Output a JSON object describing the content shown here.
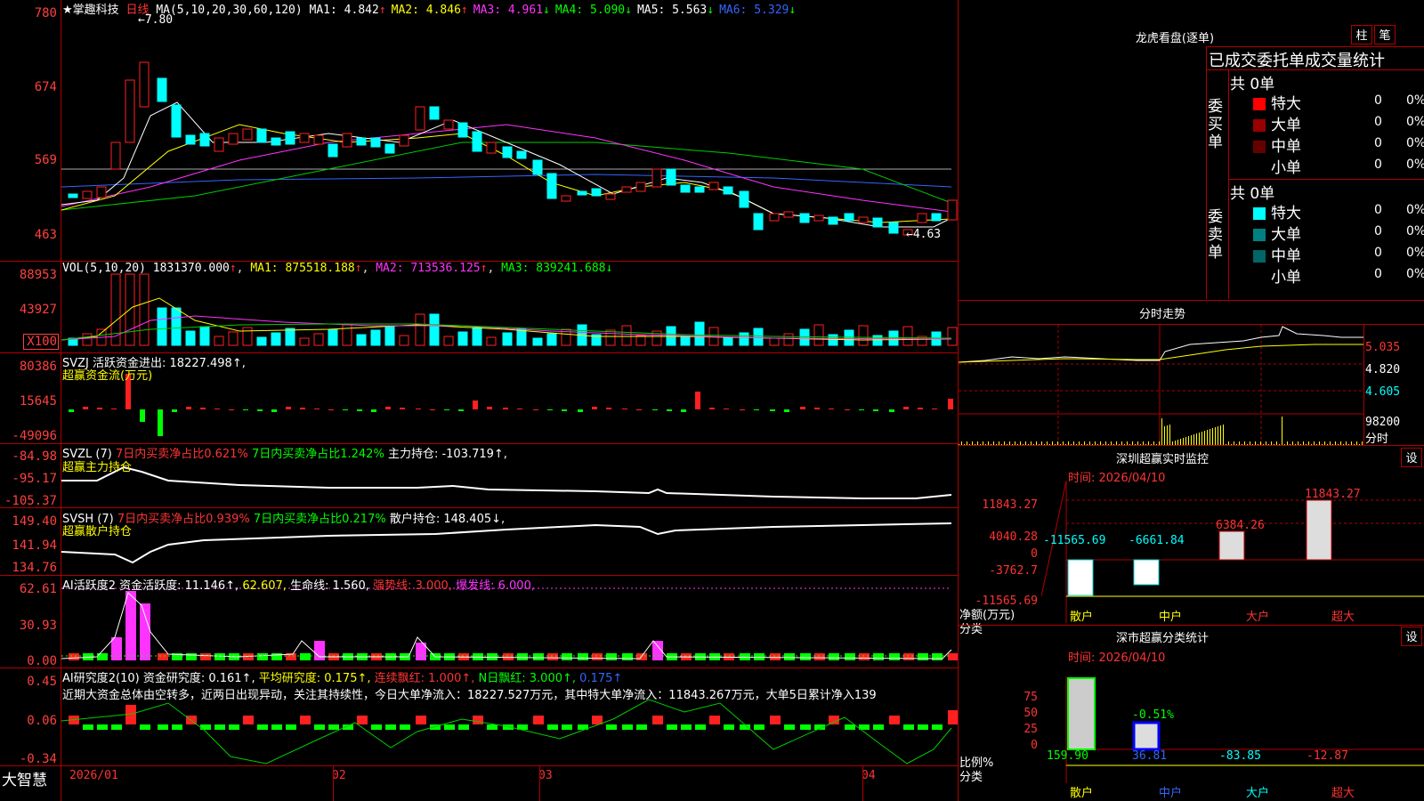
{
  "stock": {
    "name": "★掌趣科技",
    "period": "日线",
    "ma_header": "MA(5,10,20,30,60,120)",
    "ma": [
      {
        "label": "MA1: 4.842",
        "arrow": "↑",
        "color": "#ffffff"
      },
      {
        "label": "MA2: 4.846",
        "arrow": "↑",
        "color": "#ffff00"
      },
      {
        "label": "MA3: 4.961",
        "arrow": "↓",
        "color": "#ff33ff"
      },
      {
        "label": "MA4: 5.090",
        "arrow": "↓",
        "color": "#00ff00"
      },
      {
        "label": "MA5: 5.563",
        "arrow": "↓",
        "color": "#ffffff"
      },
      {
        "label": "MA6: 5.329",
        "arrow": "↓",
        "color": "#3366ff"
      }
    ],
    "high_marker": "7.80",
    "low_marker": "4.63",
    "price_axis": [
      "780",
      "674",
      "569",
      "463"
    ],
    "vol_axis": [
      "88953",
      "43927",
      "X100"
    ],
    "svzj_axis": [
      "80386",
      "15645",
      "-49096"
    ],
    "svzl_axis": [
      "-84.98",
      "-95.17",
      "-105.37"
    ],
    "svsh_axis": [
      "149.40",
      "141.94",
      "134.76"
    ],
    "ai1_axis": [
      "62.61",
      "30.93",
      "0.00"
    ],
    "ai2_axis": [
      "0.45",
      "0.06",
      "-0.34"
    ],
    "date_labels": [
      "2026/01",
      "02",
      "03",
      "04"
    ],
    "brand": "大智慧"
  },
  "vol": {
    "header": "VOL(5,10,20)",
    "value": "1831370.000",
    "ma1": "MA1: 875518.188",
    "ma2": "MA2: 713536.125",
    "ma3": "MA3: 839241.688"
  },
  "svzj": {
    "header": "SVZJ  活跃资金进出: 18227.498↑,",
    "sub": "超赢资金流(万元)"
  },
  "svzl": {
    "header": "SVZL (7)",
    "a": "7日内买卖净占比0.621%",
    "b": "7日内买卖净占比1.242%",
    "c": "主力持仓: -103.719↑,",
    "sub": "超赢主力持仓"
  },
  "svsh": {
    "header": "SVSH (7)",
    "a": "7日内买卖净占比0.939%",
    "b": "7日内买卖净占比0.217%",
    "c": "散户持仓: 148.405↓,",
    "sub": "超赢散户持仓"
  },
  "ai1": {
    "header": "AI活跃度2",
    "a": "资金活跃度: 11.146↑,",
    "b": "62.607,",
    "c": "生命线: 1.560,",
    "d": "强势线: 3.000,",
    "e": "爆发线: 6.000,"
  },
  "ai2": {
    "header": "AI研究度2(10)",
    "a": "资金研究度: 0.161↑,",
    "b": "平均研究度: 0.175↑,",
    "c": "连续飘红: 1.000↑,",
    "d": "N日飘红: 3.000↑,",
    "e": "0.175↑",
    "text": "近期大资金总体由空转多，近两日出现异动，关注其持续性，今日大单净流入：18227.527万元，其中特大单净流入：11843.267万元，大单5日累计净入139"
  },
  "right": {
    "title": "龙虎看盘(逐单)",
    "tab1": "柱",
    "tab2": "笔",
    "order_title": "已成交委托单成交量统计",
    "buy_label": "委买单",
    "sell_label": "委卖单",
    "buy_total": "共 0单",
    "sell_total": "共 0单",
    "buy_rows": [
      {
        "name": "特大",
        "val": "0",
        "pct": "0%",
        "color": "#ff0000"
      },
      {
        "name": "大单",
        "val": "0",
        "pct": "0%",
        "color": "#990000"
      },
      {
        "name": "中单",
        "val": "0",
        "pct": "0%",
        "color": "#660000"
      },
      {
        "name": "小单",
        "val": "0",
        "pct": "0%",
        "color": "#000000"
      }
    ],
    "sell_rows": [
      {
        "name": "特大",
        "val": "0",
        "pct": "0%",
        "color": "#00ffff"
      },
      {
        "name": "大单",
        "val": "0",
        "pct": "0%",
        "color": "#008080"
      },
      {
        "name": "中单",
        "val": "0",
        "pct": "0%",
        "color": "#006666"
      },
      {
        "name": "小单",
        "val": "0",
        "pct": "0%",
        "color": "#000000"
      }
    ],
    "intraday_title": "分时走势",
    "intraday_axis": [
      "5.035",
      "4.820",
      "4.605",
      "98200",
      "分时"
    ],
    "monitor_title": "深圳超赢实时监控",
    "monitor_date": "时间: 2026/04/10",
    "monitor_axis": [
      "11843.27",
      "4040.28",
      "0",
      "-3762.7",
      "-11565.69"
    ],
    "monitor_ylabel": "净额(万元)",
    "monitor_xlabel": "分类",
    "monitor_cats": [
      "散户",
      "中户",
      "大户",
      "超大"
    ],
    "monitor_values": [
      "-11565.69",
      "-6661.84",
      "6384.26",
      "11843.27"
    ],
    "class_title": "深市超赢分类统计",
    "class_date": "时间: 2026/04/10",
    "class_axis": [
      "75",
      "50",
      "25",
      "0"
    ],
    "class_ylabel": "比例%",
    "class_xlabel": "分类",
    "class_cats": [
      "散户",
      "中户",
      "大户",
      "超大"
    ],
    "class_values": [
      "159.90",
      "36.81",
      "-83.85",
      "-12.87"
    ],
    "class_note": "-0.51%",
    "set": "设"
  }
}
